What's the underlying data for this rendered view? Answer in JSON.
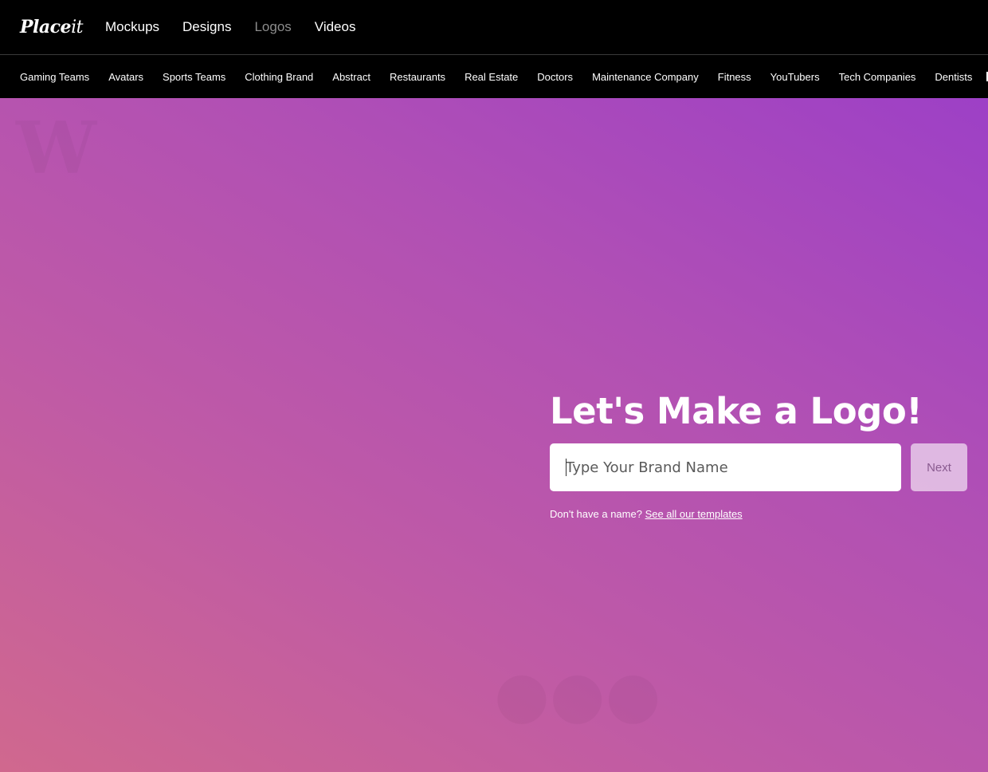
{
  "brand": {
    "name_bold": "Place",
    "name_light": "it"
  },
  "main_nav": [
    {
      "label": "Mockups",
      "active": true
    },
    {
      "label": "Designs",
      "active": true
    },
    {
      "label": "Logos",
      "active": false
    },
    {
      "label": "Videos",
      "active": true
    }
  ],
  "categories": [
    "Gaming Teams",
    "Avatars",
    "Sports Teams",
    "Clothing Brand",
    "Abstract",
    "Restaurants",
    "Real Estate",
    "Doctors",
    "Maintenance Company",
    "Fitness",
    "YouTubers",
    "Tech Companies",
    "Dentists"
  ],
  "hero": {
    "heading": "Let's Make a Logo!",
    "input_placeholder": "Type Your Brand Name",
    "next_label": "Next",
    "hint_text": "Don't have a name? ",
    "hint_link": "See all our templates"
  },
  "colors": {
    "gradient_start": "#d0688e",
    "gradient_end": "#9d40c6"
  }
}
